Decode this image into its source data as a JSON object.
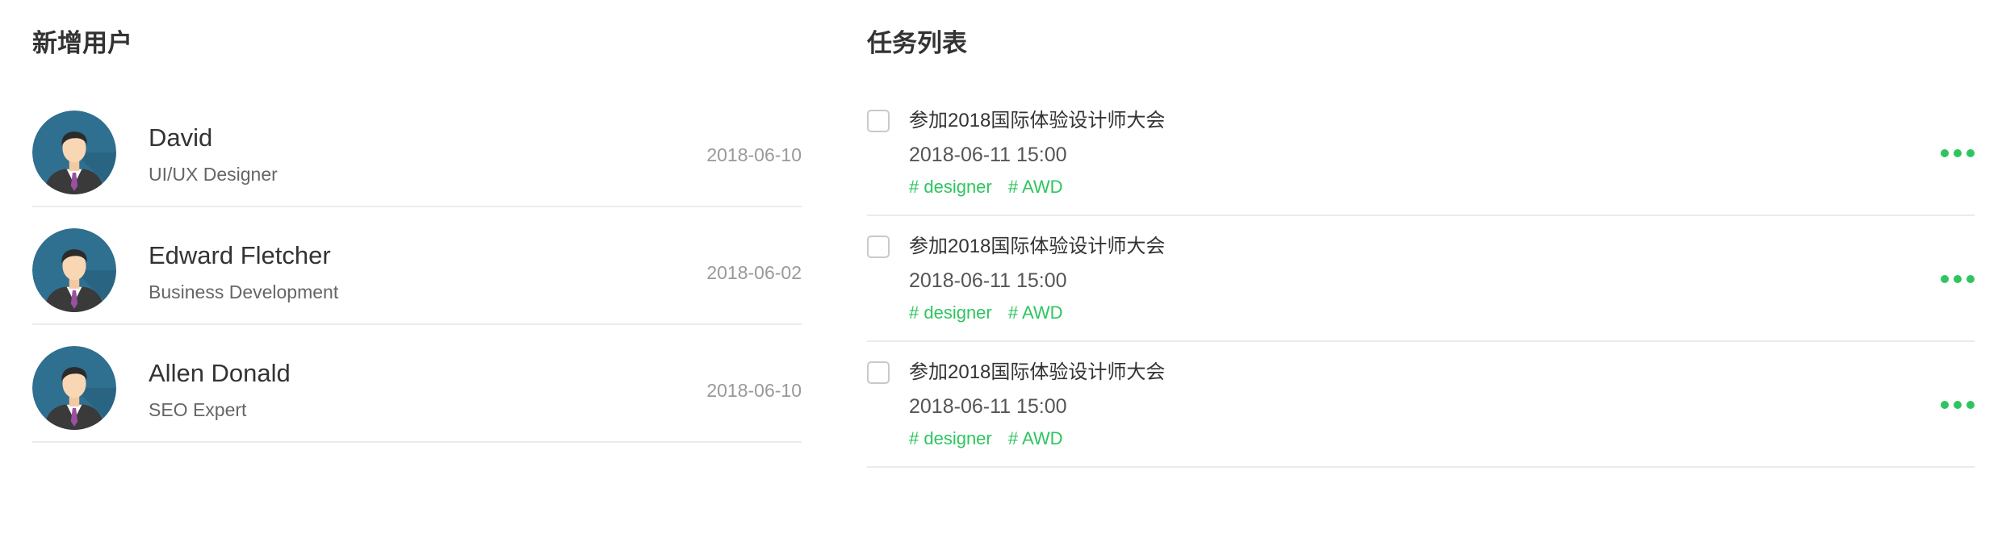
{
  "new_users": {
    "title": "新增用户",
    "users": [
      {
        "name": "David",
        "role": "UI/UX Designer",
        "date": "2018-06-10"
      },
      {
        "name": "Edward Fletcher",
        "role": "Business Development",
        "date": "2018-06-02"
      },
      {
        "name": "Allen Donald",
        "role": "SEO Expert",
        "date": "2018-06-10"
      }
    ]
  },
  "tasks": {
    "title": "任务列表",
    "items": [
      {
        "title": "参加2018国际体验设计师大会",
        "time": "2018-06-11 15:00",
        "tags": [
          "# designer",
          "# AWD"
        ],
        "checked": false
      },
      {
        "title": "参加2018国际体验设计师大会",
        "time": "2018-06-11 15:00",
        "tags": [
          "# designer",
          "# AWD"
        ],
        "checked": false
      },
      {
        "title": "参加2018国际体验设计师大会",
        "time": "2018-06-11 15:00",
        "tags": [
          "# designer",
          "# AWD"
        ],
        "checked": false
      }
    ]
  },
  "colors": {
    "accent": "#2ec55f",
    "avatar_bg": "#2f6f8f",
    "divider": "#ebebeb"
  },
  "icons": {
    "avatar": "user-avatar-icon",
    "more": "more-dots-icon",
    "checkbox": "checkbox-icon"
  }
}
